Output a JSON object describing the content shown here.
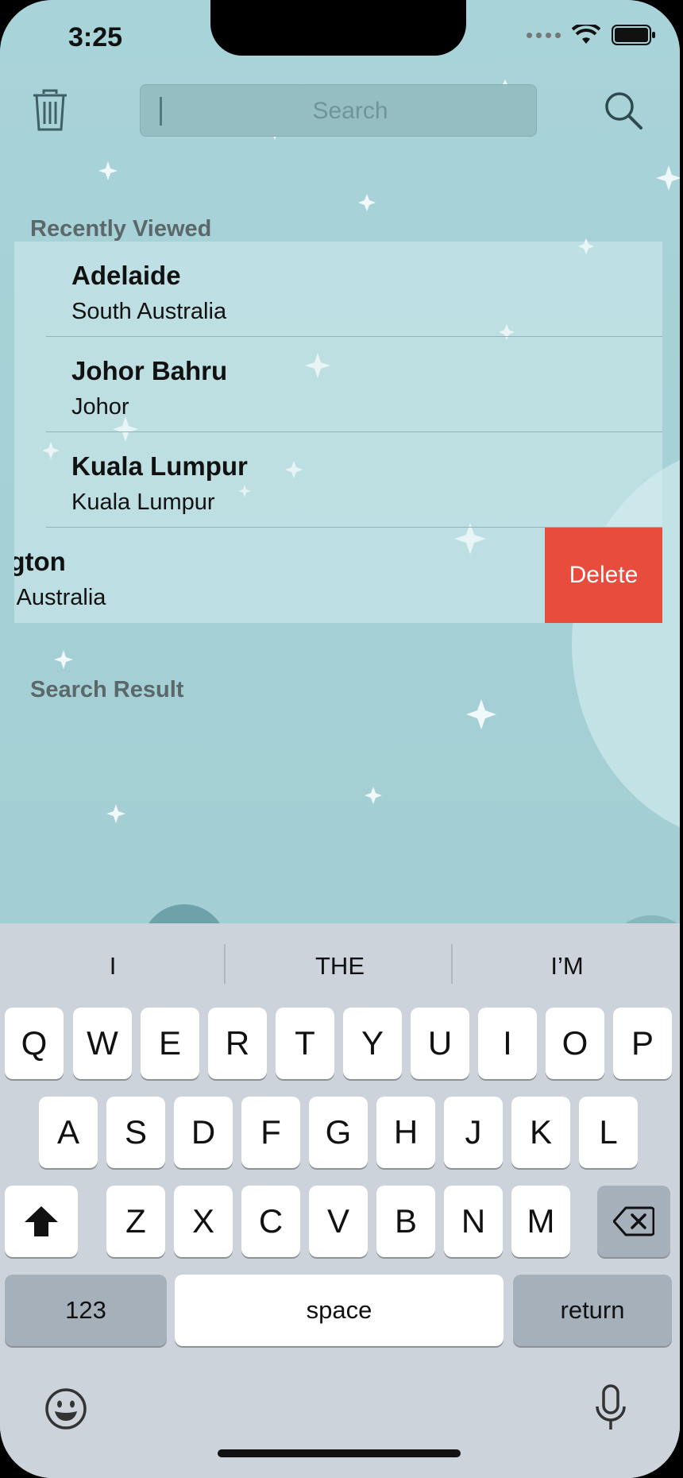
{
  "status_bar": {
    "time": "3:25"
  },
  "toolbar": {
    "search_placeholder": "Search"
  },
  "recently_viewed": {
    "title": "Recently Viewed",
    "items": [
      {
        "name": "Adelaide",
        "region": "South Australia"
      },
      {
        "name": "Johor Bahru",
        "region": "Johor"
      },
      {
        "name": "Kuala Lumpur",
        "region": "Kuala Lumpur"
      },
      {
        "name": "ington",
        "region": "n Australia"
      }
    ],
    "delete_label": "Delete"
  },
  "search_result": {
    "title": "Search Result"
  },
  "keyboard": {
    "suggestions": [
      "I",
      "THE",
      "I’M"
    ],
    "row1": [
      "Q",
      "W",
      "E",
      "R",
      "T",
      "Y",
      "U",
      "I",
      "O",
      "P"
    ],
    "row2": [
      "A",
      "S",
      "D",
      "F",
      "G",
      "H",
      "J",
      "K",
      "L"
    ],
    "row3": [
      "Z",
      "X",
      "C",
      "V",
      "B",
      "N",
      "M"
    ],
    "numbers_label": "123",
    "space_label": "space",
    "return_label": "return"
  }
}
